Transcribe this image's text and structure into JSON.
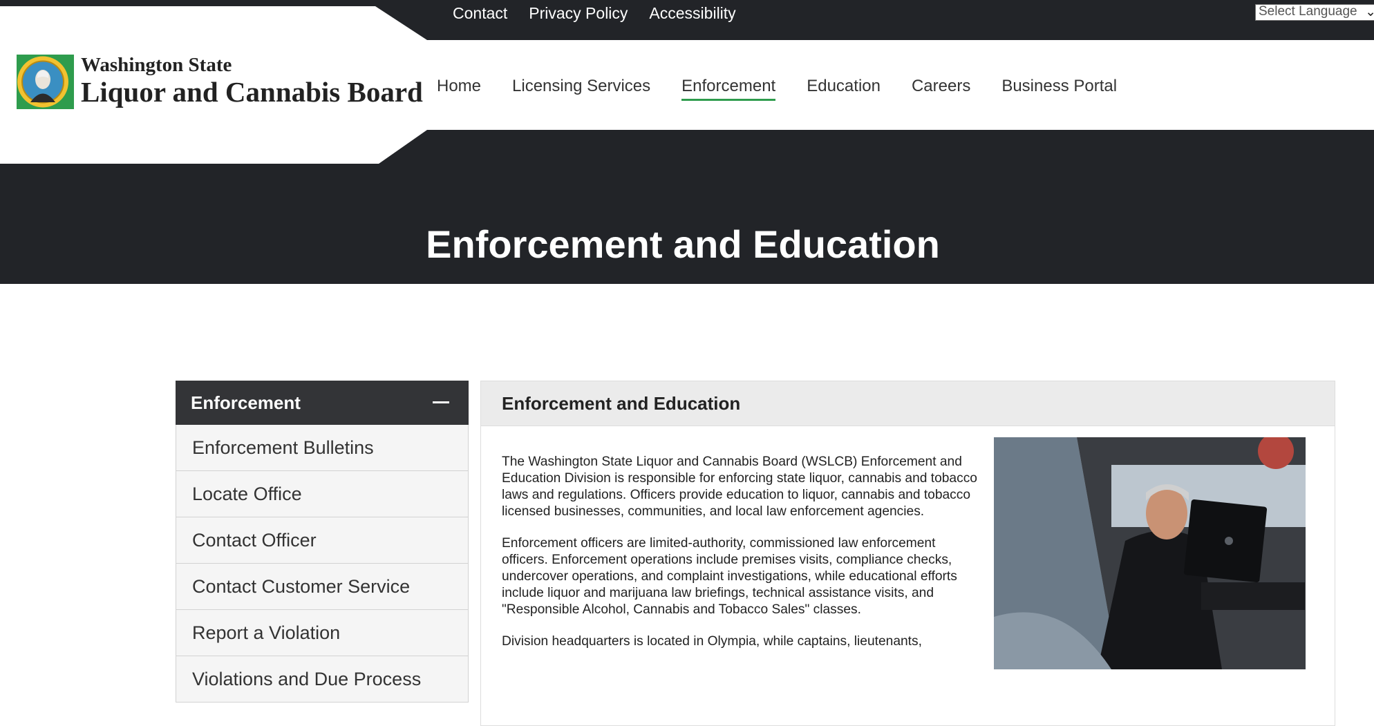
{
  "utility_nav": {
    "links": [
      "Contact",
      "Privacy Policy",
      "Accessibility"
    ],
    "language_select": "Select Language"
  },
  "brand": {
    "line1": "Washington State",
    "line2": "Liquor and Cannabis Board"
  },
  "main_nav": {
    "items": [
      "Home",
      "Licensing Services",
      "Enforcement",
      "Education",
      "Careers",
      "Business Portal"
    ],
    "active": "Enforcement"
  },
  "hero": {
    "title": "Enforcement and Education"
  },
  "sidebar": {
    "heading": "Enforcement",
    "items": [
      "Enforcement Bulletins",
      "Locate Office",
      "Contact Officer",
      "Contact Customer Service",
      "Report a Violation",
      "Violations and Due Process"
    ]
  },
  "content": {
    "heading": "Enforcement and Education",
    "paragraphs": [
      "The Washington State Liquor and Cannabis  Board (WSLCB) Enforcement and Education Division is responsible for enforcing state liquor, cannabis and tobacco laws and regulations. Officers provide education to liquor, cannabis and tobacco licensed businesses, communities, and local law enforcement agencies.",
      "Enforcement officers are limited-authority, commissioned law enforcement officers. Enforcement operations include premises visits, compliance checks, undercover operations, and complaint investigations, while educational efforts include liquor and marijuana law briefings, technical assistance visits, and \"Responsible Alcohol, Cannabis and Tobacco Sales\" classes.",
      "Division headquarters is located in Olympia, while captains, lieutenants,"
    ]
  },
  "colors": {
    "dark": "#222428",
    "accent_green": "#2e9c4d",
    "sidebar_head": "#333437"
  }
}
